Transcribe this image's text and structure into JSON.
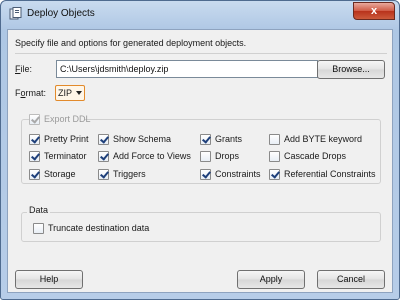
{
  "window": {
    "title": "Deploy Objects",
    "close_label": "x"
  },
  "description": "Specify file and options for generated deployment objects.",
  "file": {
    "label": "File:",
    "value": "C:\\Users\\jdsmith\\deploy.zip",
    "browse_label": "Browse..."
  },
  "format": {
    "label": "Format:",
    "value": "ZIP"
  },
  "export_ddl": {
    "label": "Export DDL",
    "checked": true,
    "enabled": false,
    "options": [
      {
        "label": "Pretty Print",
        "checked": true
      },
      {
        "label": "Show Schema",
        "checked": true
      },
      {
        "label": "Grants",
        "checked": true
      },
      {
        "label": "Add BYTE keyword",
        "checked": false
      },
      {
        "label": "Terminator",
        "checked": true
      },
      {
        "label": "Add Force to Views",
        "checked": true
      },
      {
        "label": "Drops",
        "checked": false
      },
      {
        "label": "Cascade Drops",
        "checked": false
      },
      {
        "label": "Storage",
        "checked": true
      },
      {
        "label": "Triggers",
        "checked": true
      },
      {
        "label": "Constraints",
        "checked": true
      },
      {
        "label": "Referential Constraints",
        "checked": true
      }
    ]
  },
  "data_section": {
    "label": "Data",
    "truncate": {
      "label": "Truncate destination data",
      "checked": false
    }
  },
  "buttons": {
    "help": "Help",
    "apply": "Apply",
    "cancel": "Cancel"
  },
  "colors": {
    "accent_focus": "#e28a2b",
    "titlebar": "#b7cde8",
    "close": "#cf5a44"
  }
}
